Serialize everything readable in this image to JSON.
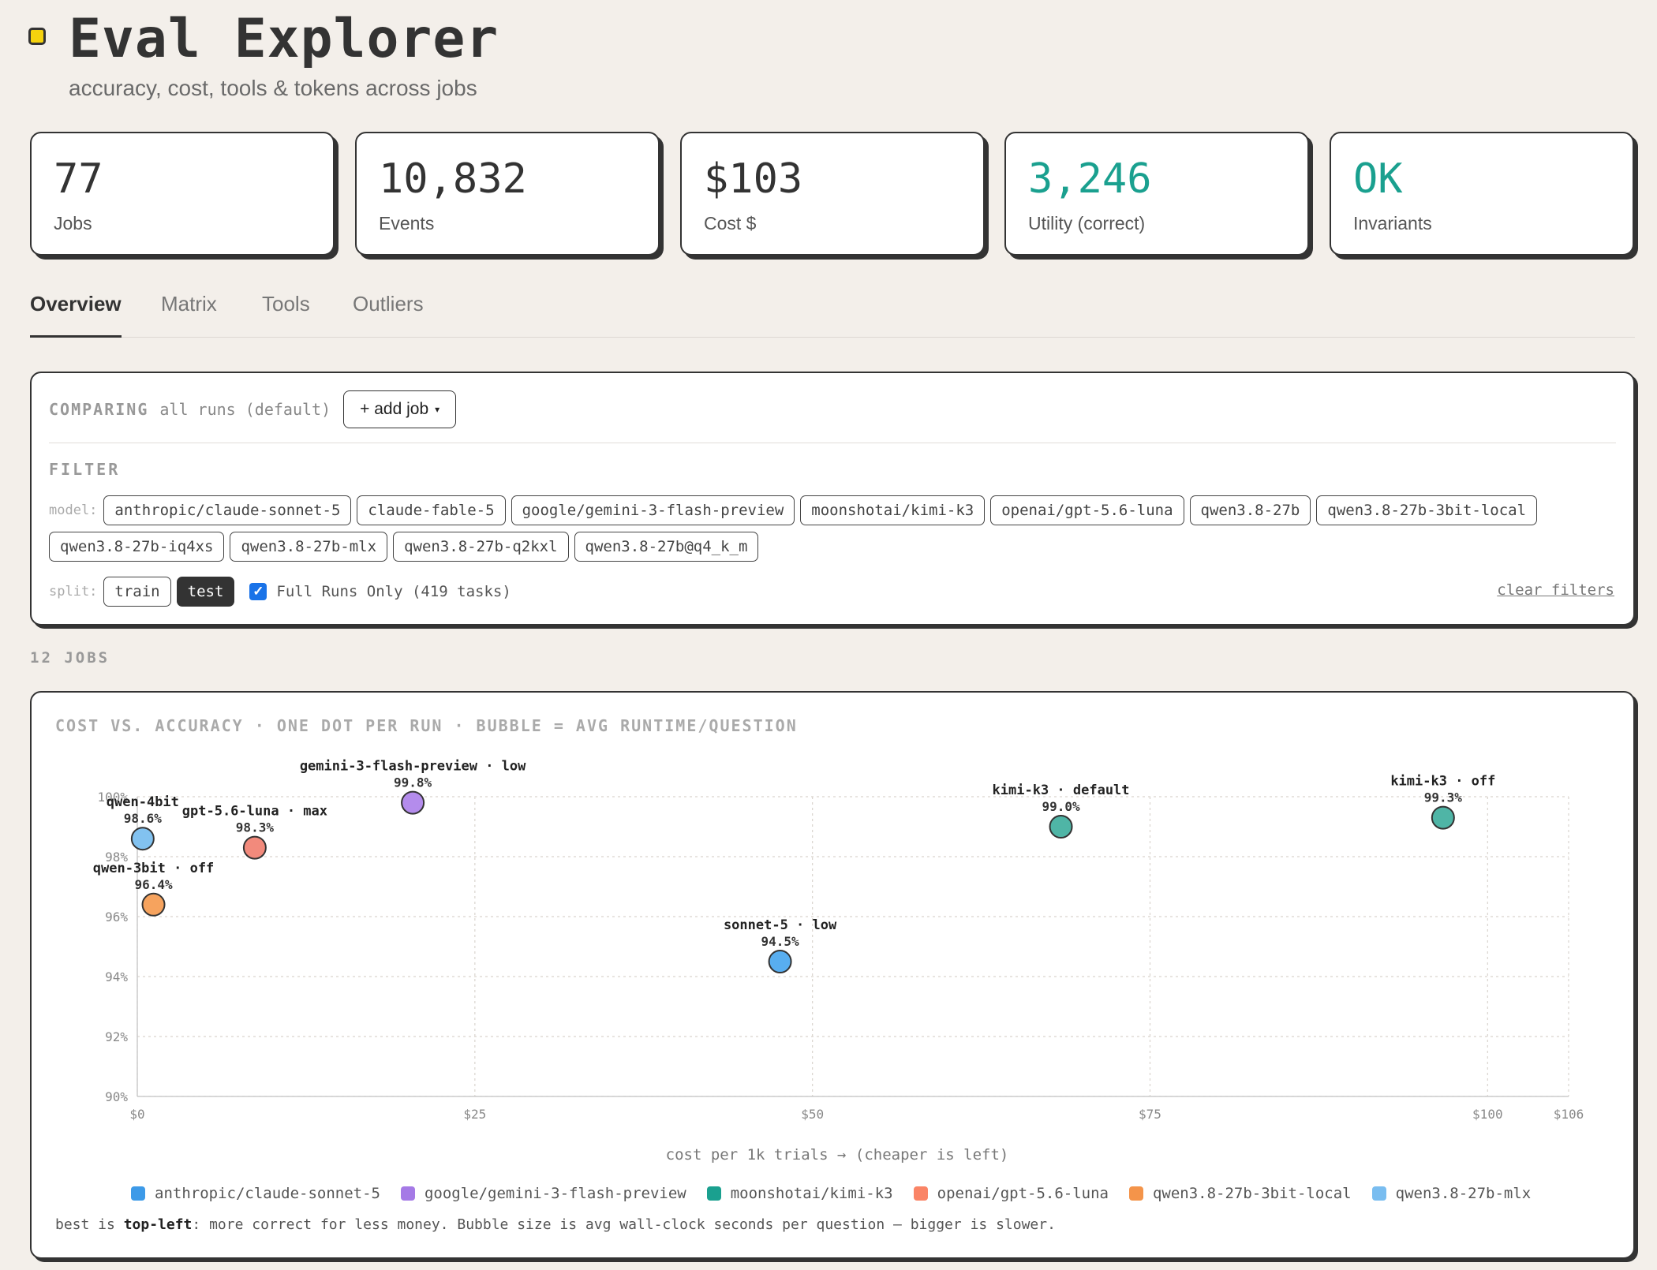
{
  "app": {
    "title": "Eval Explorer",
    "subtitle": "accuracy, cost, tools & tokens across jobs"
  },
  "stats": [
    {
      "value": "77",
      "label": "Jobs"
    },
    {
      "value": "10,832",
      "label": "Events"
    },
    {
      "value": "$103",
      "label": "Cost $"
    },
    {
      "value": "3,246",
      "label": "Utility (correct)"
    },
    {
      "value": "OK",
      "label": "Invariants"
    }
  ],
  "colors": {
    "accent_teal": "#1aa08f",
    "logo_yellow": "#f5d20e",
    "checkbox_blue": "#1a73e8"
  },
  "tabs": [
    "Overview",
    "Matrix",
    "Tools",
    "Outliers"
  ],
  "active_tab": "Overview",
  "comparing": {
    "label": "COMPARING",
    "note": "all runs (default)",
    "add_button": "+ add job",
    "add_caret": "▾"
  },
  "filter": {
    "title": "FILTER",
    "model_label": "model:",
    "models": [
      "anthropic/claude-sonnet-5",
      "claude-fable-5",
      "google/gemini-3-flash-preview",
      "moonshotai/kimi-k3",
      "openai/gpt-5.6-luna",
      "qwen3.8-27b",
      "qwen3.8-27b-3bit-local",
      "qwen3.8-27b-iq4xs",
      "qwen3.8-27b-mlx",
      "qwen3.8-27b-q2kxl",
      "qwen3.8-27b@q4_k_m"
    ],
    "split_label": "split:",
    "splits": [
      "train",
      "test"
    ],
    "selected_split": "test",
    "full_runs_checked": true,
    "full_runs_label": "Full Runs Only (419 tasks)",
    "clear_label": "clear filters"
  },
  "jobs_count": "12 JOBS",
  "chart": {
    "title": "COST VS. ACCURACY · ONE DOT PER RUN · BUBBLE = AVG RUNTIME/QUESTION",
    "footnote_prefix": "best is ",
    "footnote_bold": "top-left",
    "footnote_rest": ": more correct for less money. Bubble size is avg wall-clock seconds per question — bigger is slower."
  },
  "chart_data": {
    "type": "scatter",
    "xlabel": "cost per 1k trials → (cheaper is left)",
    "ylabel": "",
    "xlim": [
      0,
      106
    ],
    "ylim": [
      90,
      100
    ],
    "x_ticks": [
      0,
      25,
      50,
      75,
      100,
      106
    ],
    "x_tick_labels": [
      "$0",
      "$25",
      "$50",
      "$75",
      "$100",
      "$106"
    ],
    "y_ticks": [
      90,
      92,
      94,
      96,
      98,
      100
    ],
    "y_tick_labels": [
      "90%",
      "92%",
      "94%",
      "96%",
      "98%",
      "100%"
    ],
    "grid": true,
    "legend_placement": "bottom",
    "series": [
      {
        "name": "anthropic/claude-sonnet-5",
        "color": "#3d9ae8",
        "fill": "#58aef0"
      },
      {
        "name": "google/gemini-3-flash-preview",
        "color": "#a57ae6",
        "fill": "#b48cec"
      },
      {
        "name": "moonshotai/kimi-k3",
        "color": "#1aa08f",
        "fill": "#4fb5a6"
      },
      {
        "name": "openai/gpt-5.6-luna",
        "color": "#fa8466",
        "fill": "#f28a7c"
      },
      {
        "name": "qwen3.8-27b-3bit-local",
        "color": "#f4944a",
        "fill": "#f6a35e"
      },
      {
        "name": "qwen3.8-27b-mlx",
        "color": "#79bdf0",
        "fill": "#82c2f0"
      }
    ],
    "points": [
      {
        "series": "qwen3.8-27b-mlx",
        "label": "qwen-4bit",
        "acc_label": "98.6%",
        "x": 0.4,
        "y": 98.6
      },
      {
        "series": "openai/gpt-5.6-luna",
        "label": "gpt-5.6-luna · max",
        "acc_label": "98.3%",
        "x": 8.7,
        "y": 98.3
      },
      {
        "series": "qwen3.8-27b-3bit-local",
        "label": "qwen-3bit · off",
        "acc_label": "96.4%",
        "x": 1.2,
        "y": 96.4
      },
      {
        "series": "google/gemini-3-flash-preview",
        "label": "gemini-3-flash-preview · low",
        "acc_label": "99.8%",
        "x": 20.4,
        "y": 99.8
      },
      {
        "series": "anthropic/claude-sonnet-5",
        "label": "sonnet-5 · low",
        "acc_label": "94.5%",
        "x": 47.6,
        "y": 94.5
      },
      {
        "series": "moonshotai/kimi-k3",
        "label": "kimi-k3 · default",
        "acc_label": "99.0%",
        "x": 68.4,
        "y": 99.0
      },
      {
        "series": "moonshotai/kimi-k3",
        "label": "kimi-k3 · off",
        "acc_label": "99.3%",
        "x": 96.7,
        "y": 99.3
      }
    ]
  }
}
